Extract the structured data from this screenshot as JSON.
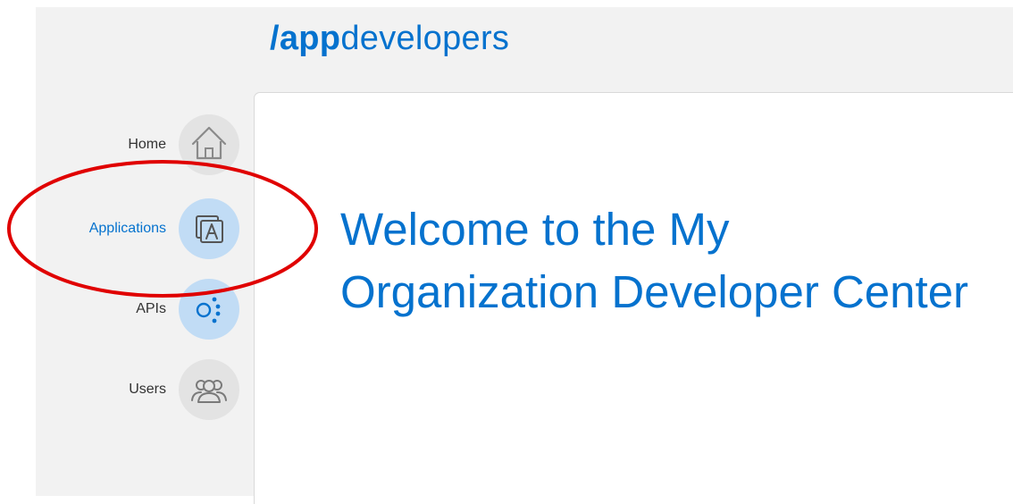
{
  "header": {
    "logo_part1": "/app",
    "logo_part2": "developers"
  },
  "sidebar": {
    "items": [
      {
        "label": "Home",
        "icon": "home-icon",
        "active": false
      },
      {
        "label": "Applications",
        "icon": "applications-icon",
        "active": true
      },
      {
        "label": "APIs",
        "icon": "apis-icon",
        "active": false
      },
      {
        "label": "Users",
        "icon": "users-icon",
        "active": false
      }
    ]
  },
  "main": {
    "welcome_text": "Welcome to the My Organization Developer Center"
  },
  "colors": {
    "brand_blue": "#0572ce",
    "active_icon_bg": "#c1dcf5",
    "icon_bg": "#e3e3e3",
    "annotation_red": "#e00000"
  }
}
